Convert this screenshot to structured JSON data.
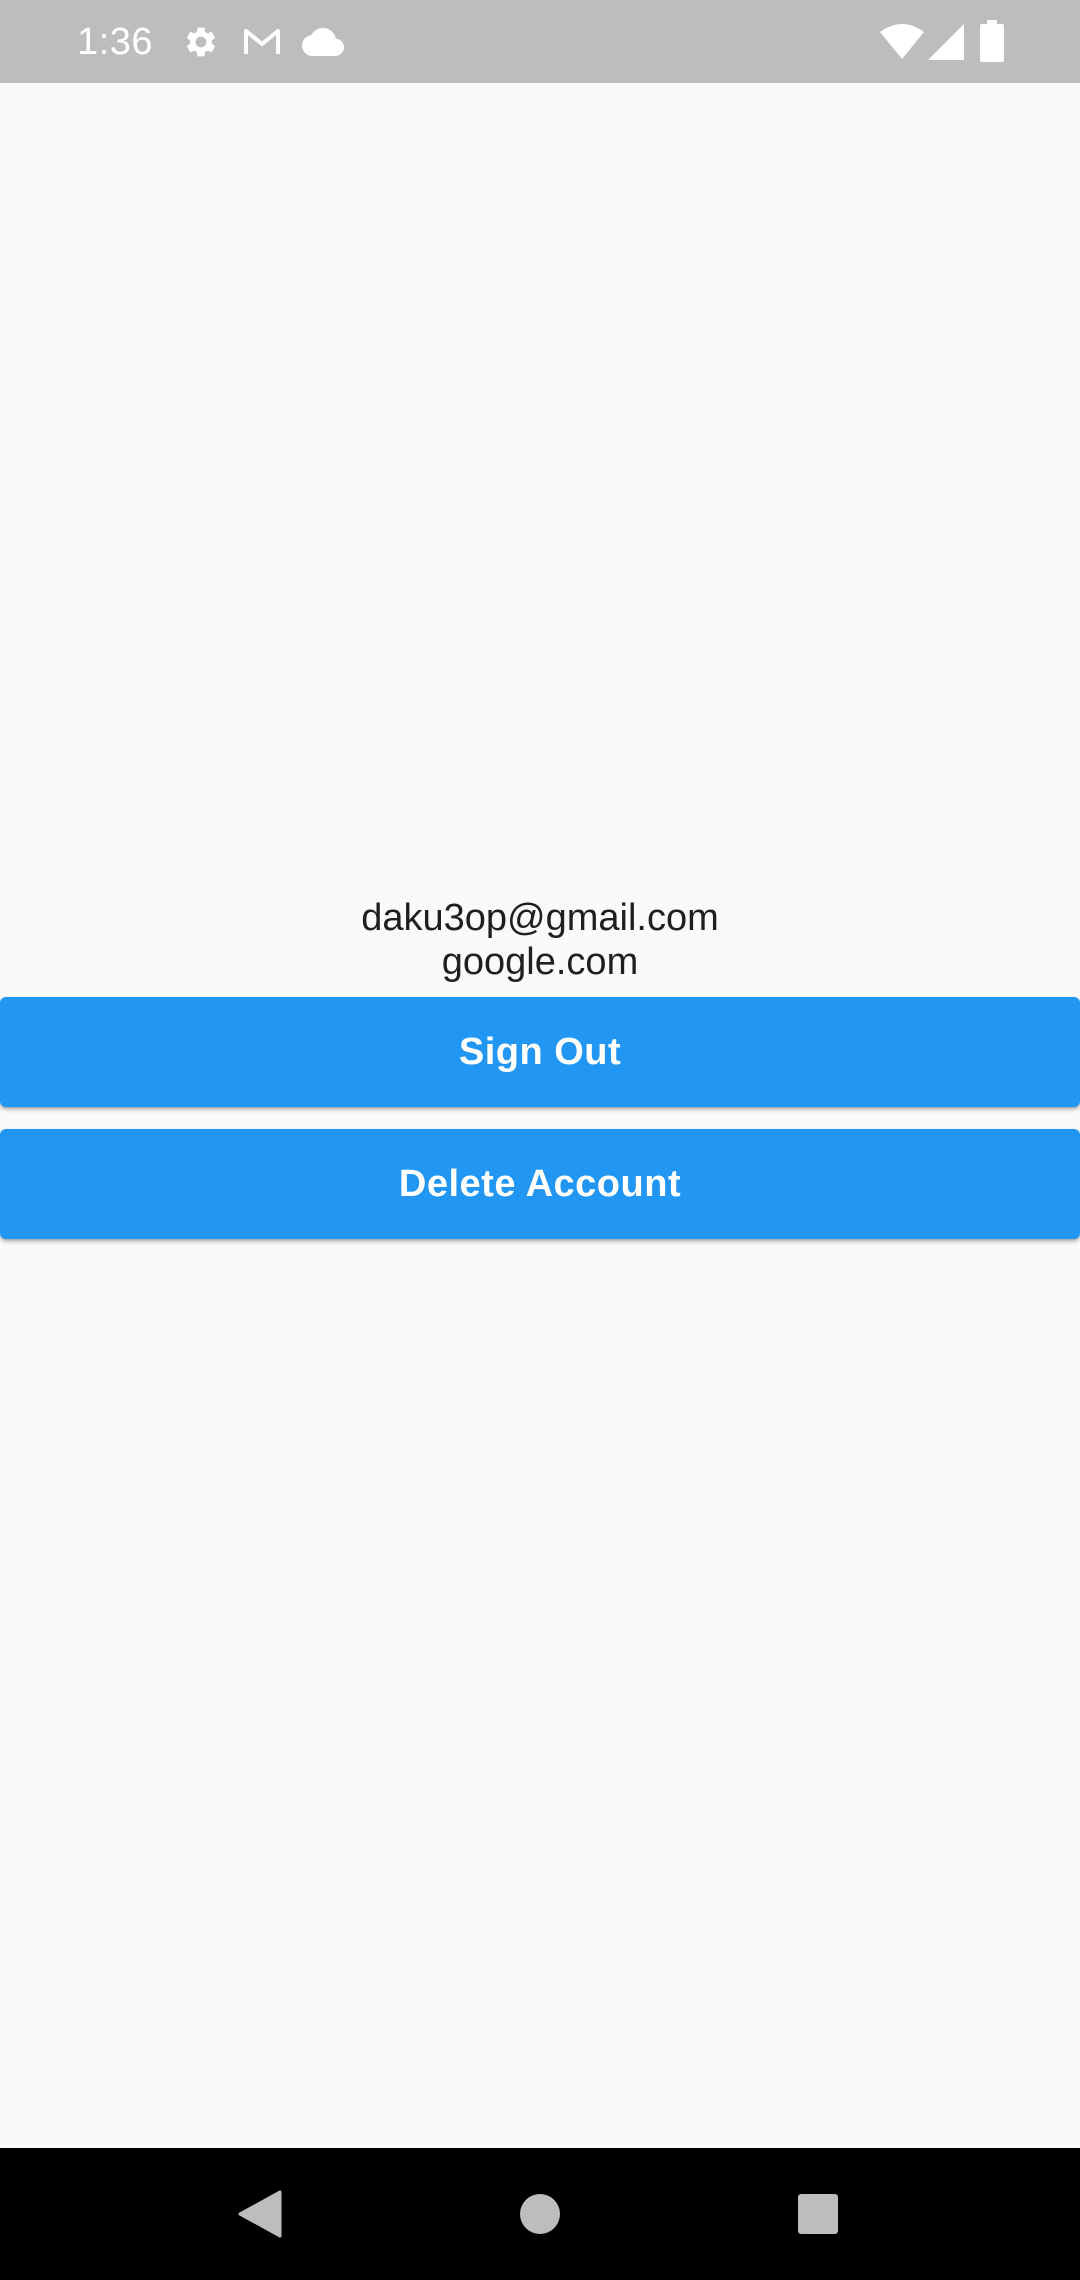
{
  "status_bar": {
    "time": "1:36",
    "left_icons": [
      "gear-icon",
      "gmail-icon",
      "cloud-icon"
    ],
    "right_icons": [
      "wifi-icon",
      "signal-icon",
      "battery-icon"
    ],
    "background": "#bdbdbd"
  },
  "account": {
    "email": "daku3op@gmail.com",
    "provider": "google.com"
  },
  "actions": {
    "sign_out_label": "Sign Out",
    "delete_account_label": "Delete Account",
    "button_color": "#2196f3"
  },
  "nav_bar": {
    "buttons": [
      "back-icon",
      "home-icon",
      "recents-icon"
    ]
  }
}
